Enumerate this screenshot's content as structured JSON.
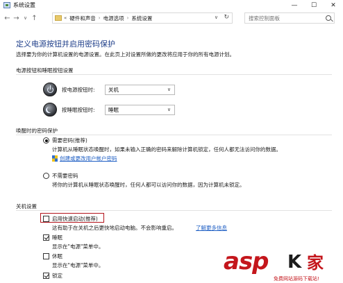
{
  "window": {
    "title": "系统设置",
    "min": "—",
    "max": "☐",
    "close": "✕"
  },
  "address": {
    "back": "←",
    "forward": "→",
    "recent": "∨",
    "up": "↑",
    "first_sep": "«",
    "crumbs": [
      "硬件和声音",
      "电源选项",
      "系统设置"
    ],
    "sep": "›",
    "dropdown": "∨",
    "refresh": "↻",
    "search_placeholder": "搜索控制面板"
  },
  "page": {
    "title": "定义电源按钮并启用密码保护",
    "description": "选择要为你的计算机设置的电源设置。在此页上对设置所做的更改将应用于你的所有电源计划。"
  },
  "power_section": {
    "header": "电源按钮和睡眠按钮设置",
    "rows": [
      {
        "label": "按电源按钮时:",
        "value": "关机",
        "arrow": "∨"
      },
      {
        "label": "按睡眠按钮时:",
        "value": "睡眠",
        "arrow": "∨"
      }
    ]
  },
  "wake_section": {
    "header": "唤醒时的密码保护",
    "require": {
      "label": "需要密码(推荐)",
      "desc": "计算机从睡眠状态唤醒时，如果未输入正确的密码来解除计算机锁定，任何人都无法访问你的数据。",
      "link": "创建或更改用户帐户密码"
    },
    "no_require": {
      "label": "不需要密码",
      "desc": "将你的计算机从睡眠状态唤醒时，任何人都可以访问你的数据，因为计算机未锁定。"
    }
  },
  "shutdown_section": {
    "header": "关机设置",
    "items": [
      {
        "label": "启用快速启动(推荐)",
        "desc": "这有助于在关机之后更快地启动电脑。不会影响重启。",
        "link": "了解更多信息"
      },
      {
        "label": "睡眠",
        "desc": "显示在\"电源\"菜单中。"
      },
      {
        "label": "休眠",
        "desc": "显示在\"电源\"菜单中。"
      },
      {
        "label": "锁定"
      }
    ]
  },
  "watermark": {
    "main": "asp",
    "k": "K",
    "cn": "家",
    "sub": "免费网站源码下载站!"
  },
  "colors": {
    "title_blue": "#1f3f8a",
    "link_blue": "#1f5fc4",
    "highlight_red": "#b3121a",
    "watermark_red": "#c4161c"
  }
}
